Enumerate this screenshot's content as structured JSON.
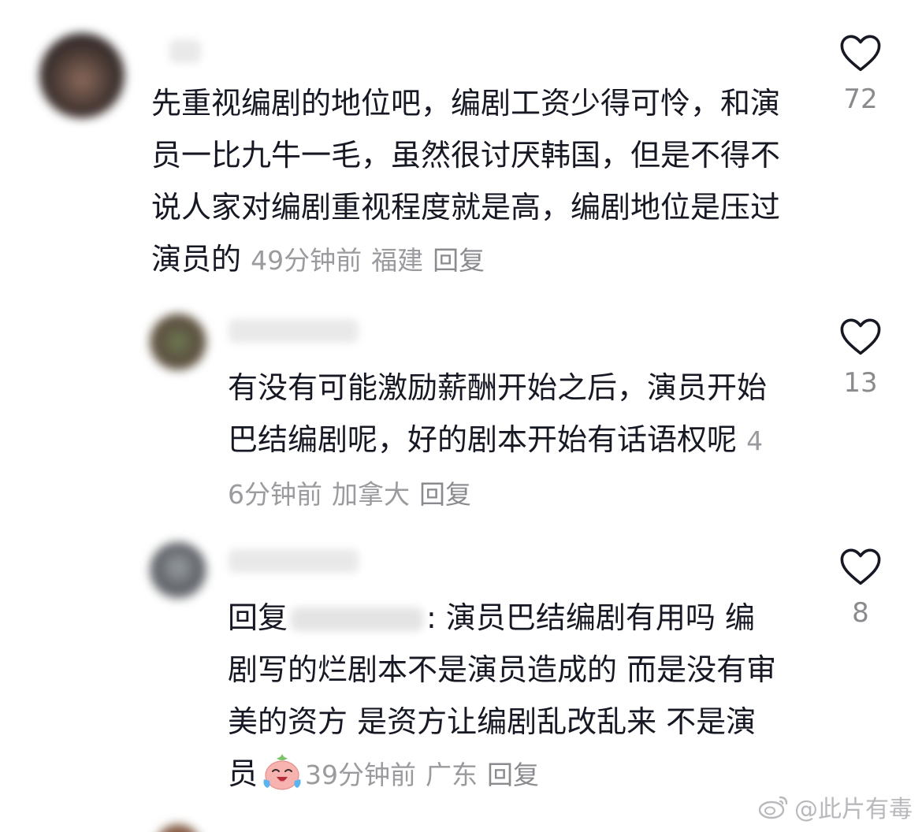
{
  "comments": [
    {
      "text": "先重视编剧的地位吧，编剧工资少得可怜，和演员一比九牛一毛，虽然很讨厌韩国，但是不得不说人家对编剧重视程度就是高，编剧地位是压过演员的",
      "time": "49分钟前",
      "location": "福建",
      "reply_label": "回复",
      "likes": "72",
      "replies": [
        {
          "text": "有没有可能激励薪酬开始之后，演员开始巴结编剧呢，好的剧本开始有话语权呢",
          "time": "46分钟前",
          "location": "加拿大",
          "reply_label": "回复",
          "likes": "13"
        },
        {
          "reply_prefix": "回复",
          "text": ": 演员巴结编剧有用吗 编剧写的烂剧本不是演员造成的 而是没有审美的资方 是资方让编剧乱改乱来 不是演员",
          "emoji_icon": "crying-laughing-face-icon",
          "time": "39分钟前",
          "location": "广东",
          "reply_label": "回复",
          "likes": "8"
        }
      ]
    }
  ],
  "watermark": "@此片有毒",
  "icons": {
    "like": "heart-outline-icon",
    "watermark": "weibo-logo-icon"
  }
}
